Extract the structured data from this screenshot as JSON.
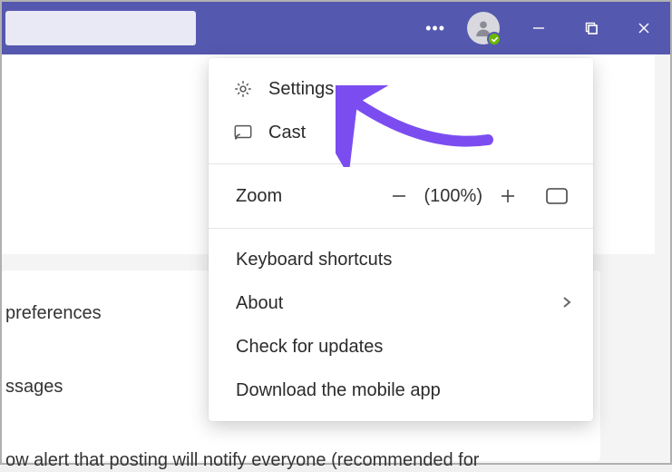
{
  "titlebar": {
    "more_tooltip": "More",
    "minimize": "Minimize",
    "maximize": "Maximize",
    "close": "Close"
  },
  "menu": {
    "settings": "Settings",
    "cast": "Cast",
    "zoom_label": "Zoom",
    "zoom_value": "(100%)",
    "keyboard_shortcuts": "Keyboard shortcuts",
    "about": "About",
    "check_updates": "Check for updates",
    "download_app": "Download the mobile app"
  },
  "background": {
    "preferences": "preferences",
    "messages": "ssages",
    "alert_line": "ow alert that posting will notify everyone (recommended for"
  }
}
